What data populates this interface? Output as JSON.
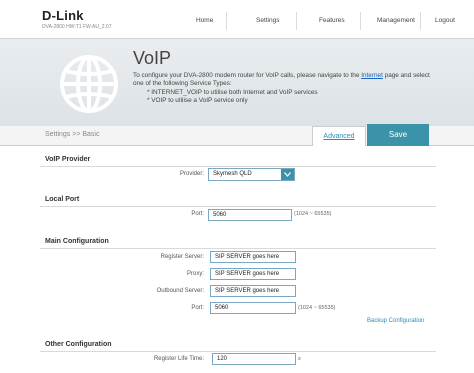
{
  "header": {
    "logo": "D-Link",
    "model_line": "DVA-2800   HW:T1   FW:AU_2.07",
    "nav": [
      "Home",
      "Settings",
      "Features",
      "Management",
      "Logout"
    ]
  },
  "hero": {
    "title": "VoIP",
    "desc_prefix": "To configure your DVA-2800 modem router for VoIP calls, please navigate to the ",
    "desc_link": "Internet",
    "desc_suffix": " page and select one of the following Service Types:",
    "bullets": [
      "* INTERNET_VOIP to utilise both Internet and VoIP services",
      "* VOIP to utilise a VoIP service only"
    ]
  },
  "toolbar": {
    "breadcrumb": "Settings >> Basic",
    "advanced_label": "Advanced",
    "save_label": "Save"
  },
  "voip_provider": {
    "title": "VoIP Provider",
    "provider_label": "Provider:",
    "provider_value": "Skymesh QLD"
  },
  "local_port": {
    "title": "Local Port",
    "port_label": "Port:",
    "port_value": "5060",
    "port_range": "(1024 ~ 65535)"
  },
  "main_config": {
    "title": "Main Configuration",
    "register_label": "Register Server:",
    "register_value": "SIP SERVER goes here",
    "proxy_label": "Proxy:",
    "proxy_value": "SIP SERVER goes here",
    "outbound_label": "Outbound Server:",
    "outbound_value": "SIP SERVER goes here",
    "port_label": "Port:",
    "port_value": "5060",
    "port_range": "(1024 ~ 65535)",
    "backup_link": "Backup Configuration"
  },
  "other_config": {
    "title": "Other Configuration",
    "life_label": "Register Life Time:",
    "life_value": "120",
    "life_suffix": "s"
  },
  "colors": {
    "accent": "#3a93a8",
    "link": "#2b8cb9",
    "input_border": "#7aa7c4"
  },
  "icons": {
    "globe": "globe-icon",
    "dropdown": "chevron-down-icon"
  }
}
